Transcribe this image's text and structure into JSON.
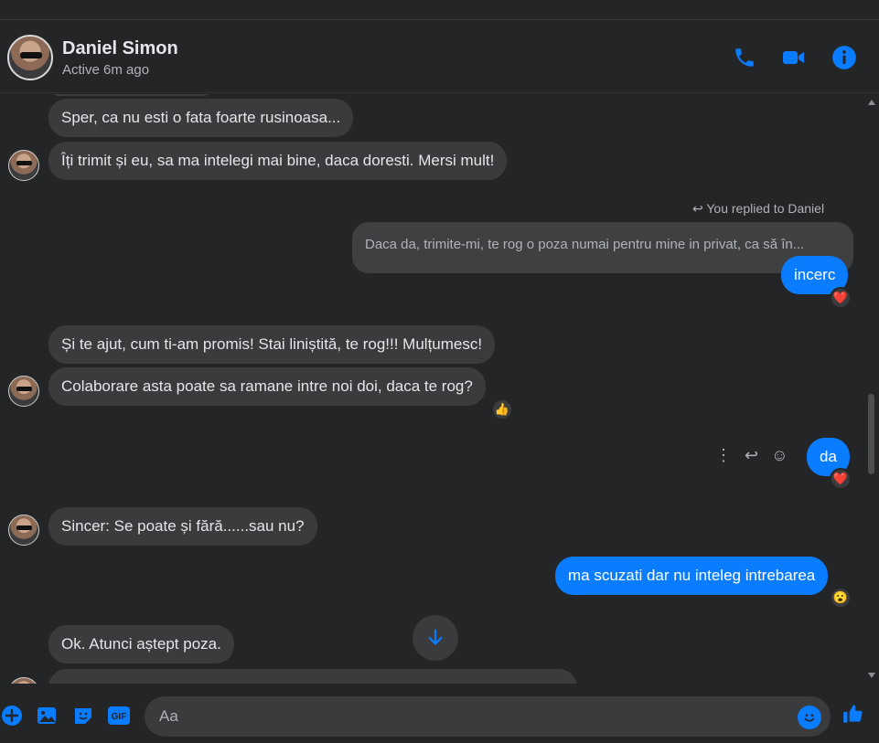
{
  "header": {
    "contact_name": "Daniel Simon",
    "contact_status": "Active 6m ago",
    "icons": [
      "phone-icon",
      "video-icon",
      "info-icon"
    ]
  },
  "thread": {
    "messages": [
      {
        "id": "m1",
        "direction": "in",
        "text": "Sper, ca nu esti o fata foarte rusinoasa..."
      },
      {
        "id": "m2",
        "direction": "in",
        "text": "Îți trimit și eu, sa ma intelegi mai bine, daca doresti. Mersi mult!"
      },
      {
        "id": "m3",
        "direction": "out",
        "replied_label": "You replied to Daniel",
        "reply_preview": "Daca da, trimite-mi, te rog o poza numai pentru mine in privat, ca să în...",
        "text": "incerc",
        "reaction": "❤️"
      },
      {
        "id": "m4",
        "direction": "in",
        "text": "Și te ajut, cum ti-am promis! Stai liniștită, te rog!!! Mulțumesc!"
      },
      {
        "id": "m5",
        "direction": "in",
        "text": "Colaborare asta poate sa ramane intre noi doi, daca te rog?",
        "reaction": "👍"
      },
      {
        "id": "m6",
        "direction": "out",
        "text": "da",
        "reaction": "❤️"
      },
      {
        "id": "m7",
        "direction": "in",
        "text": "Sincer: Se poate și fără......sau nu?"
      },
      {
        "id": "m8",
        "direction": "out",
        "text": "ma scuzati dar nu inteleg intrebarea",
        "reaction": "😮"
      },
      {
        "id": "m9",
        "direction": "in",
        "text": "Ok. Atunci aștept poza."
      }
    ]
  },
  "composer": {
    "placeholder": "Aa",
    "icons": [
      "plus-icon",
      "image-icon",
      "sticker-icon",
      "gif-icon",
      "emoji-icon",
      "like-icon"
    ]
  },
  "colors": {
    "accent": "#0a7cff",
    "background": "#242526",
    "incoming_bubble": "#3a3b3c"
  }
}
